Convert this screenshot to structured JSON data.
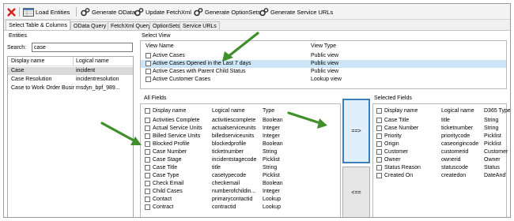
{
  "toolbar": {
    "close_icon": "red-x-icon",
    "load_entities": "Load Entities",
    "generate_odata": "Generate OData",
    "update_fetchxml": "Update FetchXml",
    "generate_optionsets": "Generate OptionSets",
    "generate_service_urls": "Generate Service URLs"
  },
  "tabs": [
    "Select Table & Columns",
    "OData Query",
    "FetchXml Query",
    "OptionSets",
    "Service URLs"
  ],
  "entities": {
    "group_label": "Entities",
    "search_label": "Search:",
    "search_value": "case",
    "columns": [
      "Display name",
      "Logical name"
    ],
    "rows": [
      [
        "Case",
        "incident"
      ],
      [
        "Case Resolution",
        "incidentresolution"
      ],
      [
        "Case to Work Order Busin...",
        "msdyn_bpf_989..."
      ]
    ]
  },
  "select_view": {
    "group_label": "Select View",
    "columns": [
      "View Name",
      "View Type"
    ],
    "rows": [
      [
        "Active Cases",
        "Public view"
      ],
      [
        "Active Cases Opened in the Last 7 days",
        "Public view"
      ],
      [
        "Active Cases with Parent Child Status",
        "Public view"
      ],
      [
        "Active Customer Cases",
        "Lookup view"
      ]
    ]
  },
  "all_fields": {
    "group_label": "All Fields",
    "columns": [
      "Display name",
      "Logical name",
      "Type"
    ],
    "rows": [
      [
        "Activities Complete",
        "activitiescomplete",
        "Boolean"
      ],
      [
        "Actual Service Units",
        "actualserviceunits",
        "Integer"
      ],
      [
        "Billed Service Units",
        "billedserviceunits",
        "Integer"
      ],
      [
        "Blocked Profile",
        "blockedprofile",
        "Boolean"
      ],
      [
        "Case Number",
        "ticketnumber",
        "String"
      ],
      [
        "Case Stage",
        "incidentstagecode",
        "Picklist"
      ],
      [
        "Case Title",
        "title",
        "String"
      ],
      [
        "Case Type",
        "casetypecode",
        "Picklist"
      ],
      [
        "Check Email",
        "checkemail",
        "Boolean"
      ],
      [
        "Child Cases",
        "numberofchildin...",
        "Integer"
      ],
      [
        "Contact",
        "primarycontactid",
        "Lookup"
      ],
      [
        "Contract",
        "contractid",
        "Lookup"
      ]
    ]
  },
  "move_buttons": {
    "add": "==>",
    "remove": "<=="
  },
  "selected_fields": {
    "group_label": "Selected Fields",
    "columns": [
      "Display name",
      "Logical name",
      "D365 Type"
    ],
    "rows": [
      [
        "Case Title",
        "title",
        "String"
      ],
      [
        "Case Number",
        "ticketnumber",
        "String"
      ],
      [
        "Priority",
        "prioritycode",
        "Picklist"
      ],
      [
        "Origin",
        "caseorigincode",
        "Picklist"
      ],
      [
        "Customer",
        "customerid",
        "Customer"
      ],
      [
        "Owner",
        "ownerid",
        "Owner"
      ],
      [
        "Status Reason",
        "statuscode",
        "Status"
      ],
      [
        "Created On",
        "createdon",
        "DateAndTime"
      ]
    ]
  },
  "colors": {
    "accent": "#3c7fc1",
    "arrow": "#3f8f2a",
    "selection": "#cde6f7"
  }
}
